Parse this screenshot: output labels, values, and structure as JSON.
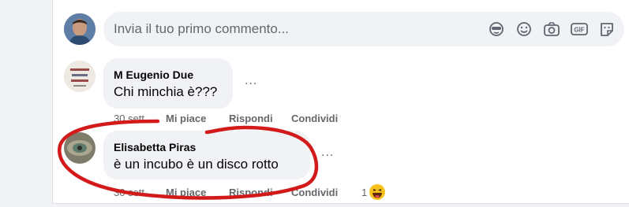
{
  "composer": {
    "placeholder": "Invia il tuo primo commento...",
    "icons": [
      "avatar-sticker-icon",
      "emoji-icon",
      "camera-icon",
      "gif-icon",
      "sticker-icon"
    ]
  },
  "comments": [
    {
      "author": "M Eugenio Due",
      "text": "Chi minchia è???",
      "time": "30 sett",
      "like_label": "Mi piace",
      "reply_label": "Rispondi",
      "share_label": "Condividi",
      "more_label": "..."
    },
    {
      "author": "Elisabetta Piras",
      "text": "è un incubo è un disco rotto",
      "time": "30 sett",
      "like_label": "Mi piace",
      "reply_label": "Rispondi",
      "share_label": "Condividi",
      "more_label": "...",
      "reaction_count": "1",
      "reaction_icon": "laughing-emoji-icon"
    }
  ],
  "colors": {
    "background": "#f0f2f5",
    "text_primary": "#050505",
    "text_secondary": "#65676b",
    "annotation_red": "#d31a1a"
  }
}
